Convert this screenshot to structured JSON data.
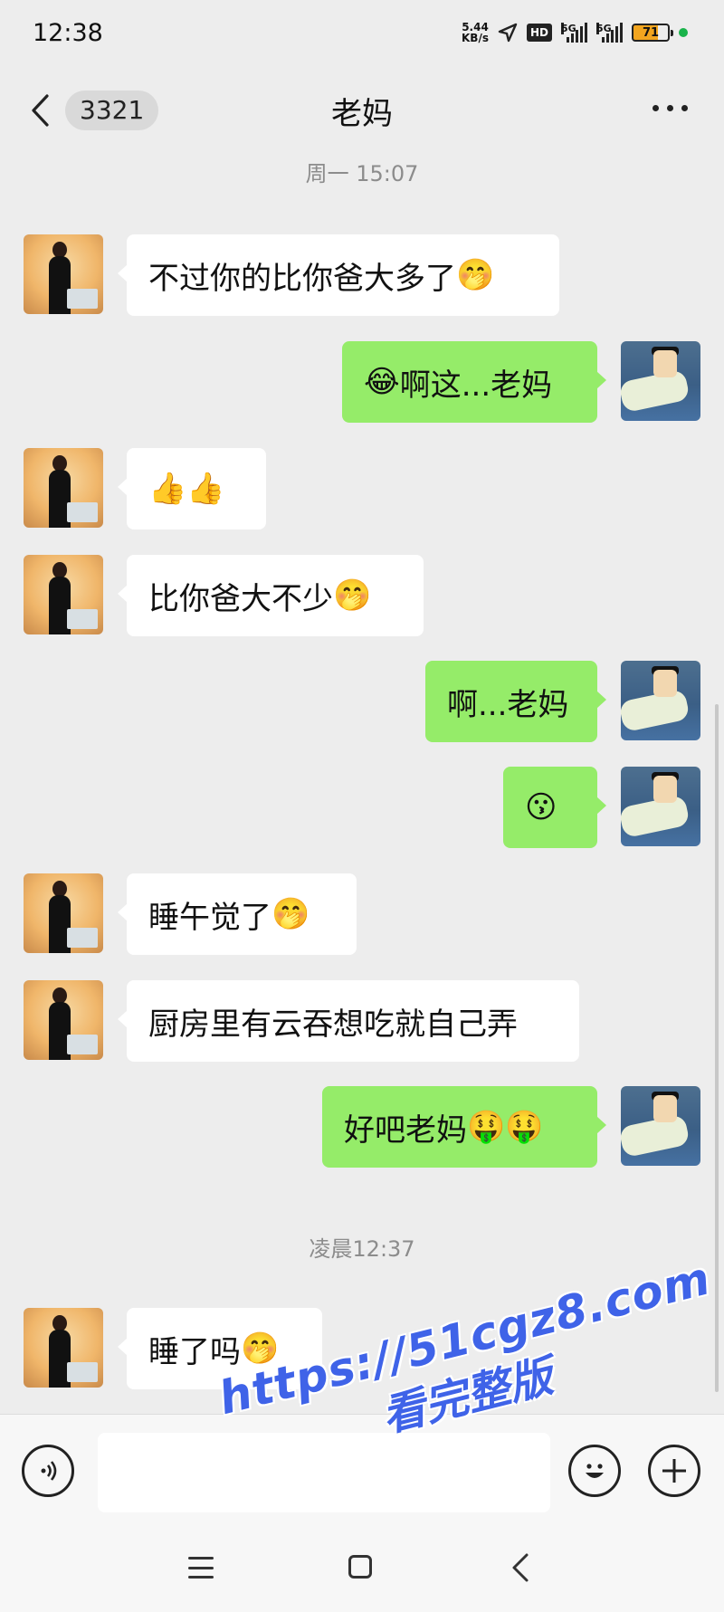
{
  "status_bar": {
    "time": "12:38",
    "net_speed_value": "5.44",
    "net_speed_unit": "KB/s",
    "hd_badge": "HD",
    "signal1_label": "5G",
    "signal2_label": "5G",
    "battery": "71"
  },
  "header": {
    "unread_count": "3321",
    "title": "老妈"
  },
  "timestamps": [
    "周一 15:07",
    "凌晨12:37"
  ],
  "messages": [
    {
      "side": "in",
      "text": "不过你的比你爸大多了",
      "emoji": "🤭"
    },
    {
      "side": "out",
      "text": "啊这...老妈",
      "emoji_before": "😂"
    },
    {
      "side": "in",
      "text": "",
      "emoji": "👍👍"
    },
    {
      "side": "in",
      "text": "比你爸大不少",
      "emoji": "🤭"
    },
    {
      "side": "out",
      "text": "啊...老妈",
      "emoji": ""
    },
    {
      "side": "out",
      "text": "",
      "emoji": "😗"
    },
    {
      "side": "in",
      "text": "睡午觉了",
      "emoji": "🤭"
    },
    {
      "side": "in",
      "text": "厨房里有云吞想吃就自己弄",
      "emoji": ""
    },
    {
      "side": "out",
      "text": "好吧老妈",
      "emoji": "🤑🤑"
    },
    {
      "side": "in",
      "text": "睡了吗",
      "emoji": "🤭"
    }
  ],
  "input_bar": {
    "voice_icon": "voice-icon",
    "emoji_icon": "smiley-icon",
    "plus_icon": "plus-icon"
  },
  "watermark": {
    "line1": "https://51cgz8.com",
    "line2": "看完整版"
  },
  "colors": {
    "background": "#ededed",
    "outgoing_bubble": "#95ec69",
    "incoming_bubble": "#ffffff",
    "watermark": "#3f63e8"
  }
}
